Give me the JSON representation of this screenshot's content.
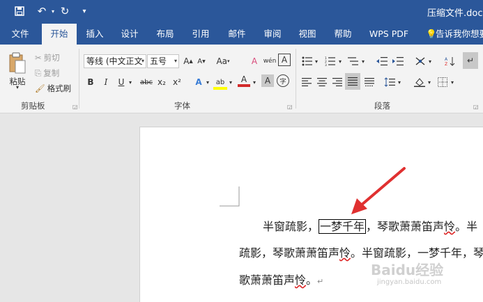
{
  "titlebar": {
    "document_title": "压缩文件.doc"
  },
  "tabs": [
    {
      "label": "文件",
      "active": false
    },
    {
      "label": "开始",
      "active": true
    },
    {
      "label": "插入",
      "active": false
    },
    {
      "label": "设计",
      "active": false
    },
    {
      "label": "布局",
      "active": false
    },
    {
      "label": "引用",
      "active": false
    },
    {
      "label": "邮件",
      "active": false
    },
    {
      "label": "审阅",
      "active": false
    },
    {
      "label": "视图",
      "active": false
    },
    {
      "label": "帮助",
      "active": false
    },
    {
      "label": "WPS PDF",
      "active": false
    },
    {
      "label": "告诉我你想要",
      "active": false
    }
  ],
  "ribbon": {
    "clipboard": {
      "paste_label": "粘贴",
      "cut_label": "剪切",
      "copy_label": "复制",
      "format_painter_label": "格式刷",
      "group_label": "剪贴板"
    },
    "font": {
      "font_name": "等线 (中文正文",
      "font_size": "五号",
      "bold": "B",
      "italic": "I",
      "underline": "U",
      "strike": "abc",
      "subscript": "x₂",
      "superscript": "x²",
      "clear": "A",
      "text_effect": "A",
      "highlight": "ab",
      "font_color": "A",
      "shading": "A",
      "enclose": "字",
      "grow": "A",
      "shrink": "A",
      "case": "Aa",
      "pinyin": "wén",
      "border": "A",
      "group_label": "字体"
    },
    "paragraph": {
      "group_label": "段落"
    }
  },
  "document": {
    "line1_before": "半窗疏影，",
    "line1_boxed": "一梦千年",
    "line1_after_a": "，琴歌萧萧笛声",
    "line1_after_b": "怜",
    "line1_after_c": "。半",
    "line2_a": "疏影，琴歌萧萧笛声",
    "line2_b": "怜",
    "line2_c": "。半窗疏影，一梦千年，琴",
    "line3_a": "歌萧萧笛声",
    "line3_b": "怜",
    "line3_c": "。",
    "pilcrow": "↵"
  },
  "watermark": {
    "brand": "Baidu经验",
    "url": "jingyan.baidu.com"
  },
  "colors": {
    "titlebar": "#2b579a",
    "ribbon": "#f3f3f3",
    "annotation_arrow": "#e03030",
    "highlight_yellow": "#ffff00",
    "font_red": "#d22b2b"
  }
}
